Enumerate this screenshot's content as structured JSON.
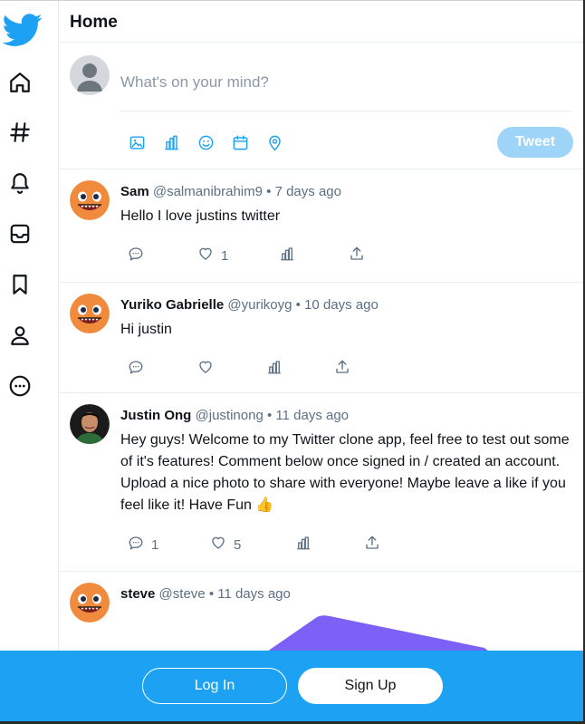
{
  "header": {
    "title": "Home"
  },
  "nav": {
    "items": [
      {
        "icon": "home-icon"
      },
      {
        "icon": "hashtag-icon"
      },
      {
        "icon": "bell-icon"
      },
      {
        "icon": "inbox-icon"
      },
      {
        "icon": "bookmark-icon"
      },
      {
        "icon": "profile-icon"
      },
      {
        "icon": "more-icon"
      }
    ]
  },
  "composer": {
    "placeholder": "What's on your mind?",
    "tweet_label": "Tweet",
    "tools": [
      "image-icon",
      "poll-icon",
      "emoji-icon",
      "schedule-icon",
      "location-icon"
    ]
  },
  "tweets": [
    {
      "name": "Sam",
      "handle": "@salmanibrahim9",
      "sep": "•",
      "time": "7 days ago",
      "text": "Hello I love justins twitter",
      "replies": "",
      "likes": "1"
    },
    {
      "name": "Yuriko Gabrielle",
      "handle": "@yurikoyg",
      "sep": "•",
      "time": "10 days ago",
      "text": "Hi justin",
      "replies": "",
      "likes": ""
    },
    {
      "name": "Justin Ong",
      "handle": "@justinong",
      "sep": "•",
      "time": "11 days ago",
      "text": "Hey guys! Welcome to my Twitter clone app, feel free to test out some of it's features! Comment below once signed in / created an account. Upload a nice photo to share with everyone! Maybe leave a like if you feel like it! Have Fun 👍",
      "replies": "1",
      "likes": "5"
    },
    {
      "name": "steve",
      "handle": "@steve",
      "sep": "•",
      "time": "11 days ago",
      "text": "",
      "replies": "",
      "likes": ""
    }
  ],
  "footer": {
    "login_label": "Log In",
    "signup_label": "Sign Up"
  },
  "colors": {
    "brand": "#1da1f2",
    "tweet_disabled": "#9dd4f8",
    "icon": "#1da1f2",
    "muted": "#5b7083",
    "purple": "#7b61f5"
  }
}
